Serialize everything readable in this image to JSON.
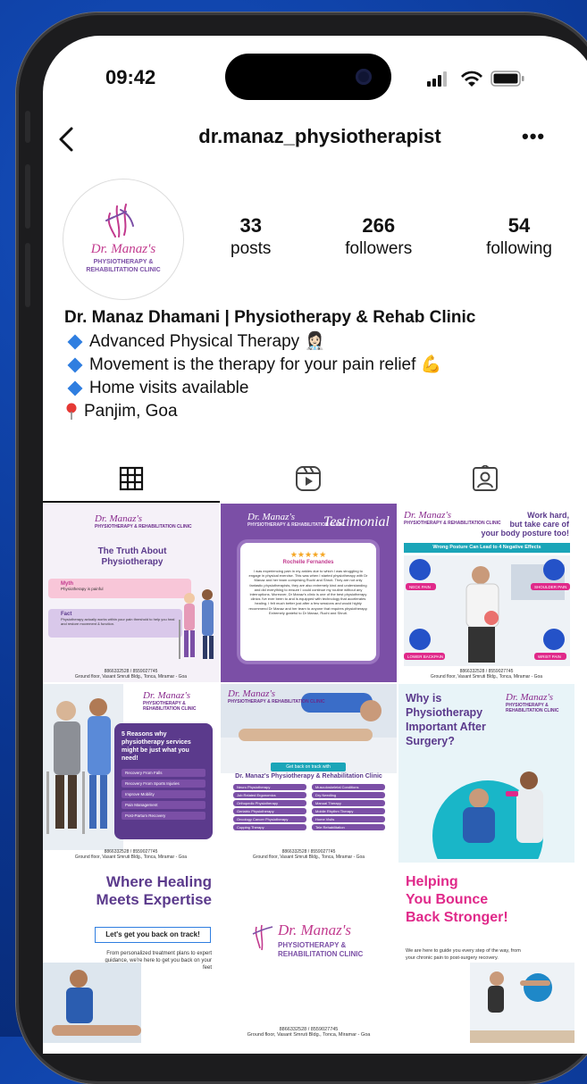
{
  "status": {
    "time": "09:42"
  },
  "nav": {
    "username": "dr.manaz_physiotherapist",
    "more": "•••"
  },
  "avatar": {
    "logo_script": "Dr. Manaz's",
    "logo_line1": "PHYSIOTHERAPY &",
    "logo_line2": "REHABILITATION CLINIC"
  },
  "stats": [
    {
      "num": "33",
      "label": "posts"
    },
    {
      "num": "266",
      "label": "followers"
    },
    {
      "num": "54",
      "label": "following"
    }
  ],
  "bio": {
    "name": "Dr. Manaz Dhamani | Physiotherapy & Rehab Clinic",
    "line1": "Advanced Physical Therapy 👩🏻‍⚕️",
    "line2": "Movement is the therapy for your pain relief 💪",
    "line3": "Home visits available",
    "line4": "Panjim, Goa"
  },
  "tabs": [
    "grid-icon",
    "reels-icon",
    "tagged-icon"
  ],
  "posts": {
    "p1": {
      "logo": "Dr. Manaz's",
      "logo_sub": "PHYSIOTHERAPY & REHABILITATION CLINIC",
      "title": "The Truth About Physiotherapy",
      "myth_label": "Myth",
      "myth_text": "Physiotherapy is painful",
      "fact_label": "Fact",
      "fact_text": "Physiotherapy actually works within your pain threshold to help you heal and restore movement & function.",
      "phone": "8866332528 / 8559027745",
      "address": "Ground floor, Vasant Smruti Bldg., Tonca, Miramar - Goa"
    },
    "p2": {
      "logo": "Dr. Manaz's",
      "logo_sub": "PHYSIOTHERAPY & REHABILITATION CLINIC",
      "heading": "Testimonial",
      "stars": "★★★★★",
      "reviewer": "Rochelle Fernandes",
      "review": "I was experiencing pain in my ankles due to which I was struggling to engage in physical exercise. This was when I started physiotherapy with Dr Manaz and her team comprising Ruchi and Shruti. They are not only fantastic physiotherapists, they are also extremely kind and understanding and did everything to ensure I could continue my routine without any interruptions. Moreover, Dr Manaz's clinic is one of the best physiotherapy clinics I've ever been to and is equipped with technology that accelerates healing. I felt much better just after a few sessions and would highly recommend Dr Manaz and her team to anyone that requires physiotherapy. Extremely grateful to Dr Manaz, Ruchi and Shruti."
    },
    "p3": {
      "logo": "Dr. Manaz's",
      "logo_sub": "PHYSIOTHERAPY & REHABILITATION CLINIC",
      "headline1": "Work hard,",
      "headline2": "but take care of",
      "headline3": "your body posture too!",
      "banner": "Wrong Posture Can Lead to 4 Negative Effects",
      "e1": "NECK PAIN",
      "e2": "SHOULDER PAIN",
      "e3": "LOWER BACKPAIN",
      "e4": "WRIST PAIN",
      "phone": "8866332528 / 8559027745",
      "address": "Ground floor, Vasant Smruti Bldg., Tonca, Miramar - Goa"
    },
    "p4": {
      "logo": "Dr. Manaz's",
      "logo_sub": "PHYSIOTHERAPY & REHABILITATION CLINIC",
      "title": "5 Reasons why physiotherapy services might be just what you need!",
      "items": [
        "Recovery From Falls",
        "Recovery From Sports Injuries",
        "Improve Mobility",
        "Pain Management",
        "Post-Partum Recovery"
      ],
      "phone": "8866332528 / 8559027745",
      "address": "Ground floor, Vasant Smruti Bldg., Tonca, Miramar - Goa"
    },
    "p5": {
      "logo": "Dr. Manaz's",
      "logo_sub": "PHYSIOTHERAPY & REHABILITATION CLINIC",
      "tag": "Get back on track with",
      "title": "Dr. Manaz's Physiotherapy & Rehabilitation Clinic",
      "services": [
        "Neuro Physiotherapy",
        "Musculoskeletal Conditions",
        "Job Related Ergonomics",
        "Dry Needling",
        "Orthopedic Physiotherapy",
        "Manual Therapy",
        "Geriatric Physiotherapy",
        "Mobile Rhythm Therapy",
        "Oncology Cancer Physiotherapy",
        "Home Visits",
        "Cupping Therapy",
        "Tele Rehabilitation"
      ],
      "phone": "8866332528 / 8559027745",
      "address": "Ground floor, Vasant Smruti Bldg., Tonca, Miramar - Goa"
    },
    "p6": {
      "title1": "Why is",
      "title2": "Physiotherapy",
      "title3": "Important After",
      "title4": "Surgery?",
      "logo": "Dr. Manaz's",
      "logo_sub": "PHYSIOTHERAPY & REHABILITATION CLINIC"
    },
    "p7": {
      "title1": "Where Healing",
      "title2": "Meets Expertise",
      "cta": "Let's get you back on track!",
      "body": "From personalized treatment plans to expert guidance, we're here to get you back on your feet"
    },
    "p8": {
      "logo": "Dr. Manaz's",
      "logo_sub1": "PHYSIOTHERAPY &",
      "logo_sub2": "REHABILITATION CLINIC",
      "phone": "8866332528 / 8559027745",
      "address": "Ground floor, Vasant Smruti Bldg., Tonca, Miramar - Goa"
    },
    "p9": {
      "title1": "Helping",
      "title2": "You Bounce",
      "title3": "Back Stronger!",
      "body": "We are here to guide you every step of the way, from your chronic pain to post-surgery recovery."
    }
  },
  "colors": {
    "accent_purple": "#7b4fa6",
    "pink": "#e0298a",
    "blue_link": "#2f7ee0"
  }
}
